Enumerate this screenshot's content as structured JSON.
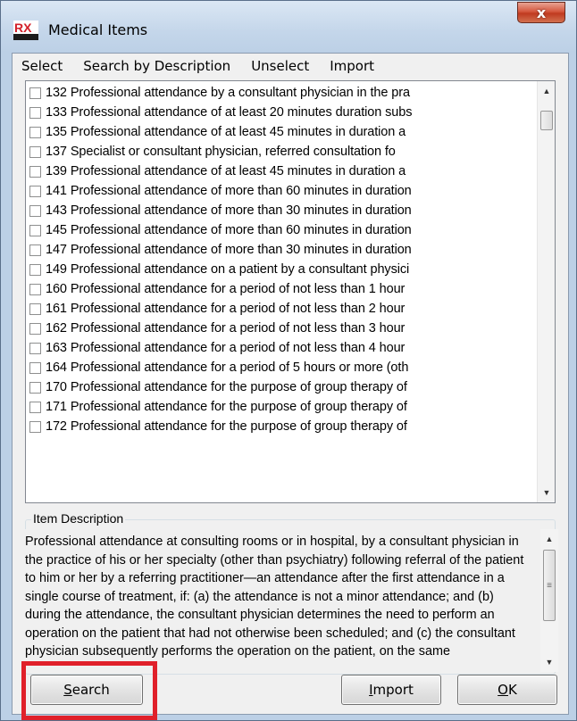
{
  "window": {
    "title": "Medical Items",
    "close_label": "x",
    "logo_text": "RX"
  },
  "menu": [
    "Select",
    "Search by Description",
    "Unselect",
    "Import"
  ],
  "items": [
    "132 Professional attendance by a consultant physician in the pra",
    "133 Professional attendance of at least 20 minutes duration subs",
    "135 Professional attendance of at least 45 minutes in duration a",
    "137 Specialist or consultant physician, referred consultation fo",
    "139 Professional attendance of at least 45 minutes in duration a",
    "141 Professional attendance of more than 60 minutes in duration",
    "143 Professional attendance of more than 30 minutes in duration",
    "145 Professional attendance of more than 60 minutes in duration",
    "147 Professional attendance of more than 30 minutes in duration",
    "149 Professional attendance on a patient by a consultant physici",
    "160 Professional attendance for a period of not less than 1 hour",
    "161 Professional attendance for a period of not less than 2 hour",
    "162 Professional attendance for a period of not less than 3 hour",
    "163 Professional attendance for a period of not less than 4 hour",
    "164 Professional attendance for a period of 5 hours or more (oth",
    "170 Professional attendance for the purpose of group therapy of",
    "171 Professional attendance for the purpose of group therapy of",
    "172 Professional attendance for the purpose of group therapy of"
  ],
  "description": {
    "label": "Item Description",
    "text": "Professional attendance at consulting rooms or in hospital, by a consultant physician in the practice of his or her specialty (other than psychiatry) following referral of the patient to him or her by a referring practitioner—an attendance after the first attendance in a single course of treatment, if: (a) the attendance is not a minor attendance; and (b) during the attendance, the consultant physician determines the need to perform an operation on the patient that had not otherwise been scheduled; and (c) the consultant physician subsequently performs the operation on the patient, on the same"
  },
  "buttons": {
    "search": {
      "mnemonic": "S",
      "rest": "earch"
    },
    "import": {
      "mnemonic": "I",
      "rest": "mport"
    },
    "ok": {
      "mnemonic": "O",
      "rest": "K"
    }
  },
  "colors": {
    "highlight": "#e0202a",
    "logo_red": "#d3202a"
  }
}
